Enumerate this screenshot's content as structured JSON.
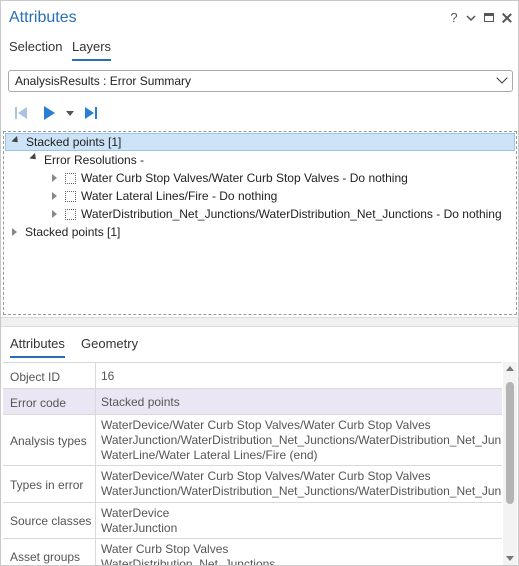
{
  "window": {
    "title": "Attributes",
    "help_label": "?"
  },
  "top_tabs": [
    {
      "label": "Selection"
    },
    {
      "label": "Layers"
    }
  ],
  "dropdown": {
    "value": "AnalysisResults : Error Summary"
  },
  "tree": {
    "root": "Stacked points [1]",
    "group": "Error Resolutions -",
    "items": [
      "Water Curb Stop Valves/Water Curb Stop Valves - Do nothing",
      "Water Lateral Lines/Fire - Do nothing",
      "WaterDistribution_Net_Junctions/WaterDistribution_Net_Junctions - Do nothing"
    ],
    "second_root": "Stacked points [1]"
  },
  "bottom_tabs": [
    {
      "label": "Attributes"
    },
    {
      "label": "Geometry"
    }
  ],
  "grid": [
    {
      "label": "Object ID",
      "values": [
        "16"
      ]
    },
    {
      "label": "Error code",
      "values": [
        "Stacked points"
      ]
    },
    {
      "label": "Analysis types",
      "values": [
        "WaterDevice/Water Curb Stop Valves/Water Curb Stop Valves",
        "WaterJunction/WaterDistribution_Net_Junctions/WaterDistribution_Net_Jun",
        "WaterLine/Water Lateral Lines/Fire (end)"
      ]
    },
    {
      "label": "Types in error",
      "values": [
        "WaterDevice/Water Curb Stop Valves/Water Curb Stop Valves",
        "WaterJunction/WaterDistribution_Net_Junctions/WaterDistribution_Net_Jun"
      ]
    },
    {
      "label": "Source classes",
      "values": [
        "WaterDevice",
        "WaterJunction"
      ]
    },
    {
      "label": "Asset groups",
      "values": [
        "Water Curb Stop Valves",
        "WaterDistribution_Net_Junctions"
      ]
    }
  ],
  "colors": {
    "accent": "#2a6fb6",
    "selection": "#cde3f7",
    "highlight_row": "#ebe6f4"
  }
}
